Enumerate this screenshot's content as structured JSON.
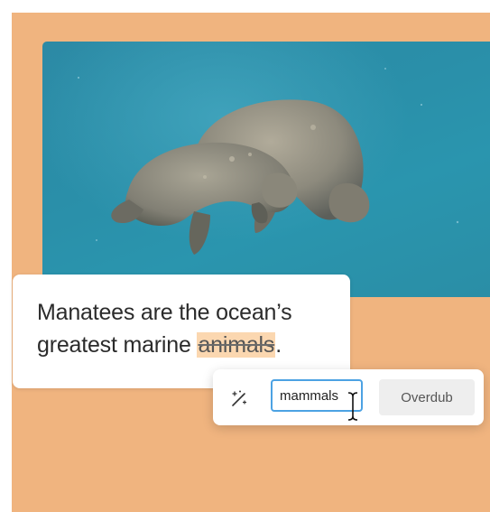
{
  "photo": {
    "subject_icon": "manatee-photo"
  },
  "caption": {
    "text_before": "Manatees are the ocean’s greatest marine ",
    "struck_word": "animals",
    "text_after": "."
  },
  "toolbar": {
    "wand_icon": "magic-wand-icon",
    "replacement_value": "mammals",
    "overdub_label": "Overdub"
  },
  "colors": {
    "background": "#f0b47f",
    "highlight": "#fbd7b0",
    "input_border": "#4ca2e3"
  }
}
